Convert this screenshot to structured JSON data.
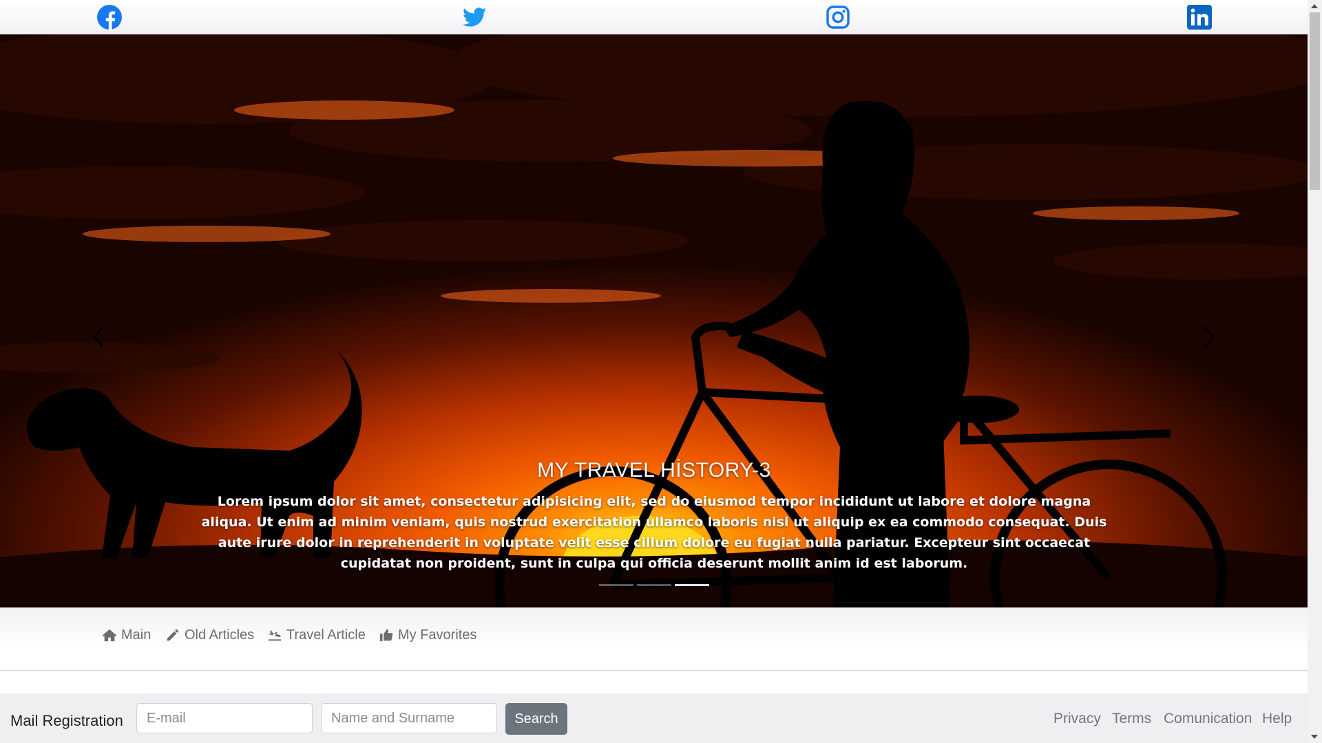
{
  "social": [
    {
      "name": "facebook",
      "icon": "facebook-icon",
      "color": "#1877f2"
    },
    {
      "name": "twitter",
      "icon": "twitter-icon",
      "color": "#1d9bf0"
    },
    {
      "name": "instagram",
      "icon": "instagram-icon",
      "color": "#1877f2"
    },
    {
      "name": "linkedin",
      "icon": "linkedin-icon",
      "color": "#0a66c2"
    }
  ],
  "carousel": {
    "title": "MY TRAVEL HİSTORY-3",
    "text": "Lorem ipsum dolor sit amet, consectetur adipisicing elit, sed do eiusmod tempor incididunt ut labore et dolore magna aliqua. Ut enim ad minim veniam, quis nostrud exercitation ullamco laboris nisi ut aliquip ex ea commodo consequat. Duis aute irure dolor in reprehenderit in voluptate velit esse cillum dolore eu fugiat nulla pariatur. Excepteur sint occaecat cupidatat non proident, sunt in culpa qui officia deserunt mollit anim id est laborum.",
    "prev_icon": "chevron-left-icon",
    "next_icon": "chevron-right-icon",
    "slides": 3,
    "active_slide": 3
  },
  "nav": {
    "items": [
      {
        "label": "Main",
        "icon": "home-icon"
      },
      {
        "label": "Old Articles",
        "icon": "pencil-icon"
      },
      {
        "label": "Travel Article",
        "icon": "plane-icon"
      },
      {
        "label": "My Favorites",
        "icon": "thumbs-up-icon"
      }
    ]
  },
  "footer": {
    "mail_label": "Mail Registration",
    "email_placeholder": "E-mail",
    "name_placeholder": "Name and Surname",
    "search_label": "Search",
    "links": [
      "Privacy",
      "Terms",
      "Comunication",
      "Help"
    ]
  }
}
